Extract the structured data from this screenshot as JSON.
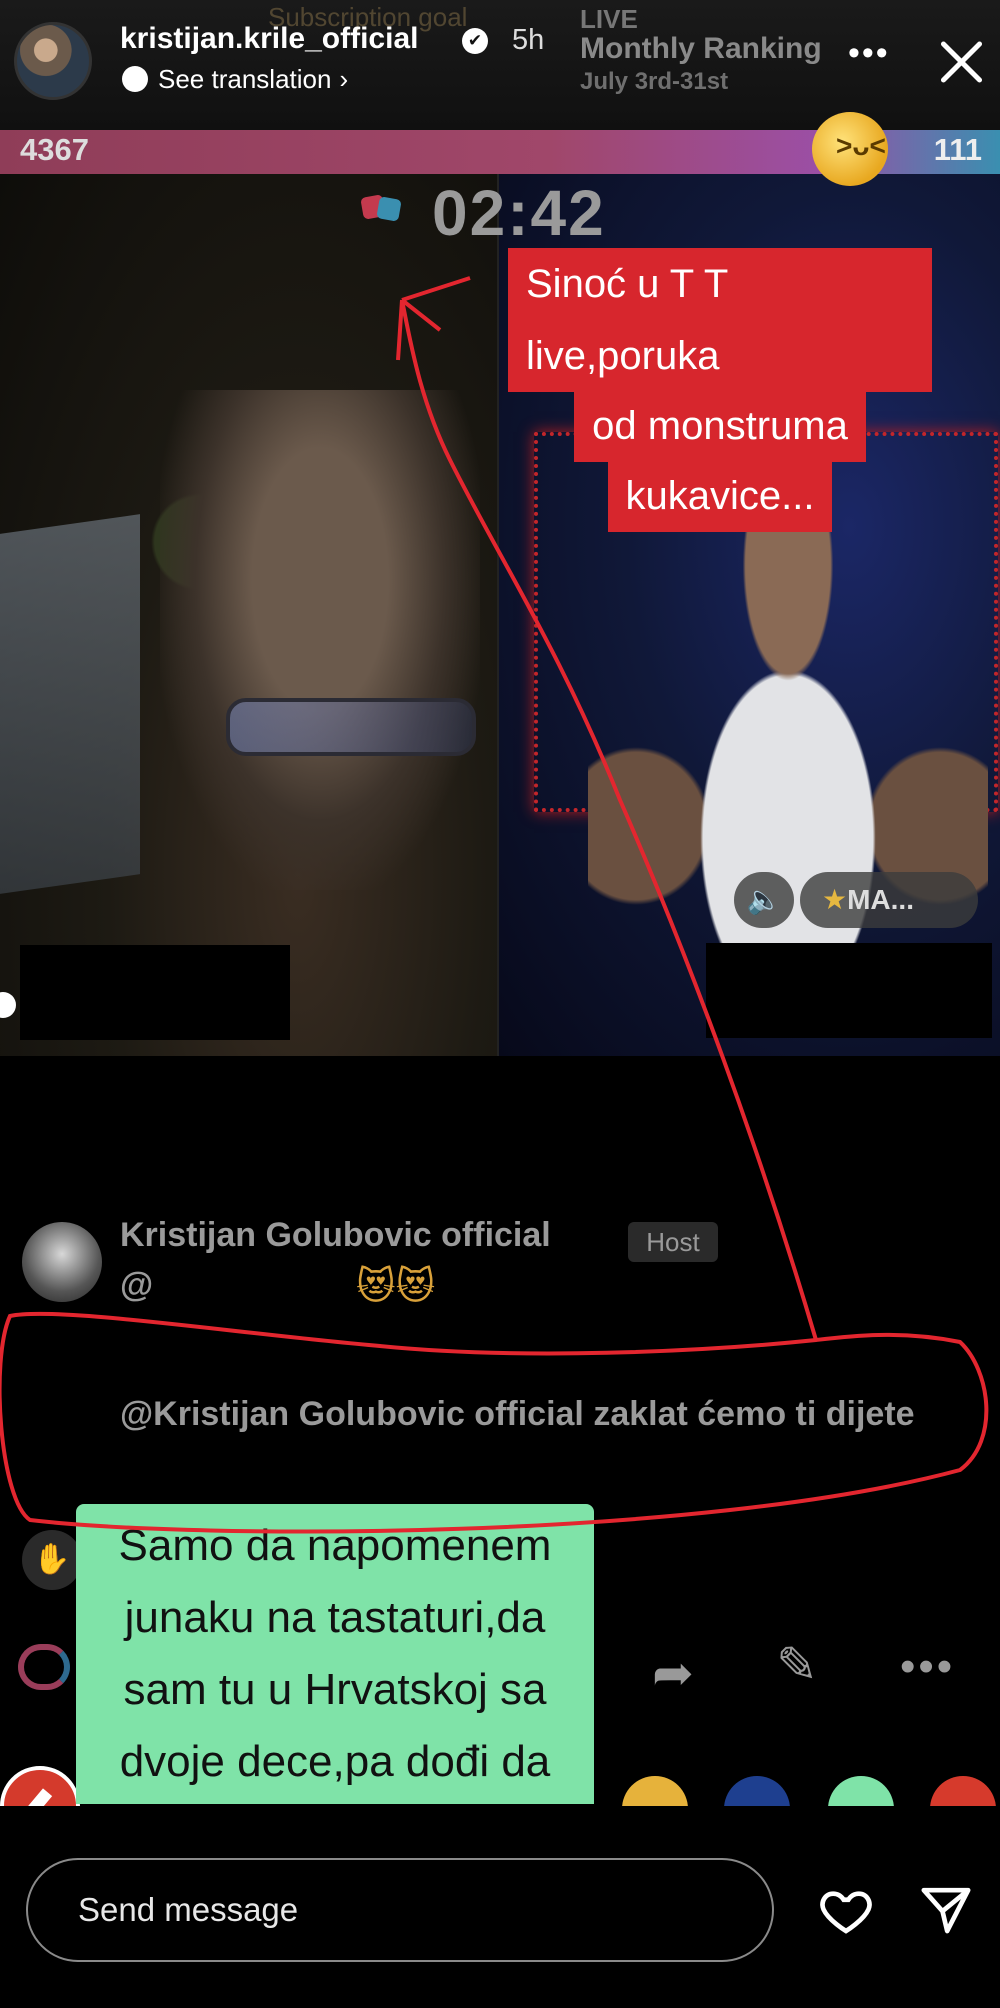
{
  "header": {
    "username": "kristijan.krile_official",
    "time_ago": "5h",
    "translation": "See translation",
    "ghost_banner": "Subscription goal",
    "live_label": "LIVE",
    "ranking_title": "Monthly Ranking",
    "ranking_dates": "July 3rd-31st",
    "more": "•••"
  },
  "battle": {
    "score_left": "4367",
    "score_right": "111",
    "timer": "02:42",
    "tag_label": "MA..."
  },
  "captions": {
    "top": [
      "Sinoć u T T live,poruka",
      "od monstruma",
      "kukavice..."
    ],
    "bottom": "Samo da napomenem junaku na tastaturi,da sam tu u Hrvatskoj sa dvoje dece,pa dođi da"
  },
  "chat": {
    "name": "Kristijan Golubovic official",
    "badge": "Host",
    "mention": "@",
    "emoji": "😻😻",
    "message": "@Kristijan Golubovic official zaklat ćemo ti dijete"
  },
  "palette": {
    "dots": [
      "#e6b23b",
      "#1e3f8f",
      "#7fe3a8",
      "#d63a2c"
    ],
    "caption_red": "#d7262d",
    "caption_green": "#7fe3a8",
    "annotation": "#e3262f"
  },
  "footer": {
    "message_placeholder": "Send message"
  },
  "icons": {
    "close": "close-icon",
    "heart": "heart-icon",
    "send": "send-icon",
    "share": "share-icon",
    "more": "more-icon"
  }
}
